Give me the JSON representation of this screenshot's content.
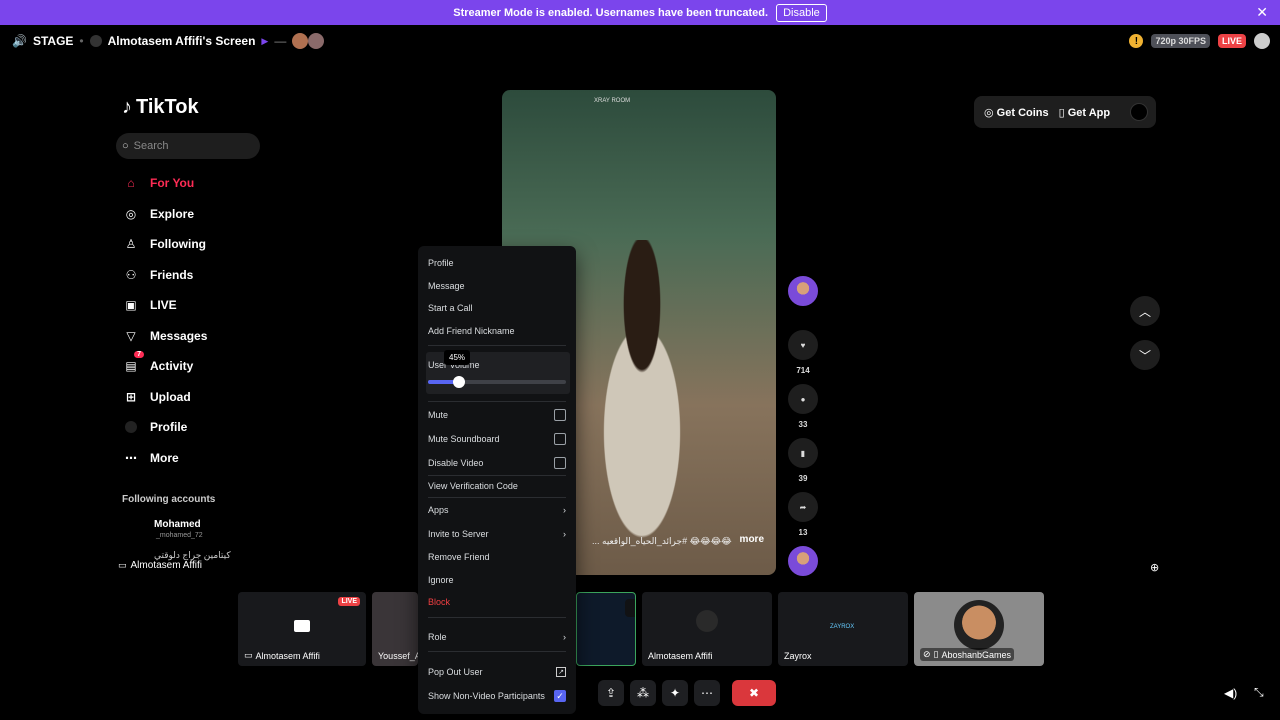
{
  "banner": {
    "message": "Streamer Mode is enabled. Usernames have been truncated.",
    "disable_label": "Disable",
    "close": "✕"
  },
  "stage": {
    "label": "STAGE",
    "screen_title": "Almotasem Affifi's Screen",
    "quality": "720p 30FPS",
    "live": "LIVE"
  },
  "tiktok": {
    "logo": "TikTok",
    "search_placeholder": "Search",
    "nav": [
      "For You",
      "Explore",
      "Following",
      "Friends",
      "LIVE",
      "Messages",
      "Activity",
      "Upload",
      "Profile",
      "More"
    ],
    "activity_badge": "7",
    "following_header": "Following accounts",
    "account1_name": "Mohamed",
    "account1_handle": "_mohamed_72",
    "account2_name": "كيتامين جراج دلوقتي",
    "get_coins": "Get Coins",
    "get_app": "Get App",
    "likes": "714",
    "comments": "33",
    "saves": "39",
    "shares": "13",
    "caption": "... جرائد_الحياه_الواقعيه# 😂😂😂😂",
    "more": "more",
    "room_sign": "XRAY ROOM"
  },
  "screen_owner": "Almotasem Affifi",
  "tiles": [
    {
      "name": "Almotasem Affifi",
      "live": "LIVE"
    },
    {
      "name": "Youssef_A"
    },
    {
      "name": "Almotasem Affifi"
    },
    {
      "name": "Zayrox",
      "tag": "ZAYROX"
    },
    {
      "name": "AboshanbGames"
    }
  ],
  "menu": {
    "profile": "Profile",
    "message": "Message",
    "start_call": "Start a Call",
    "add_nickname": "Add Friend Nickname",
    "user_volume": "User Volume",
    "volume_tip": "45%",
    "volume_value": 45,
    "mute": "Mute",
    "mute_soundboard": "Mute Soundboard",
    "disable_video": "Disable Video",
    "verification": "View Verification Code",
    "apps": "Apps",
    "invite": "Invite to Server",
    "remove_friend": "Remove Friend",
    "ignore": "Ignore",
    "block": "Block",
    "role": "Role",
    "pop_out": "Pop Out User",
    "show_non_video": "Show Non-Video Participants"
  },
  "colors": {
    "accent": "#5865f2",
    "banner": "#7b45ec",
    "danger": "#f23f42",
    "tiktok_red": "#fe2c55"
  }
}
